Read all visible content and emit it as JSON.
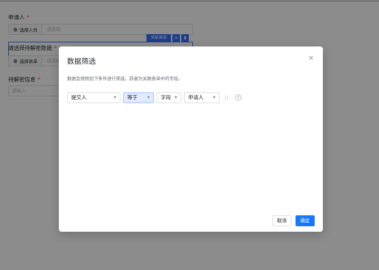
{
  "form": {
    "applicant_label": "申请人",
    "applicant_required": "*",
    "select_person_btn": "选择人员",
    "applicant_placeholder": "请选择",
    "assoc_form_btn": "关联表单",
    "choose_data_label": "请选择待解密数据",
    "choose_data_required": "*",
    "select_form_btn": "选择表单",
    "choose_data_placeholder": "请选择",
    "decrypt_info_label": "待解密信息",
    "decrypt_info_required": "*",
    "decrypt_info_placeholder": "请输入"
  },
  "modal": {
    "title": "数据筛选",
    "close": "×",
    "description": "数据会按照如下条件进行筛选，前者为关联表单中的字段。",
    "filter_row": {
      "field": "提交人",
      "operator": "等于",
      "value_type": "字段",
      "value": "申请人"
    },
    "cancel_label": "取消",
    "ok_label": "确定"
  },
  "icons": {
    "plus": "⊕",
    "trash": "🗑",
    "add": "+",
    "arrow": "▼"
  },
  "colors": {
    "primary": "#1677ff",
    "accent": "#3370ff",
    "required": "#f54a45"
  }
}
